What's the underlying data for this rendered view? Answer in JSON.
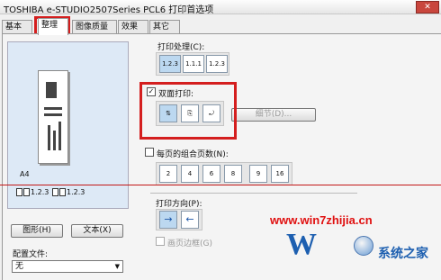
{
  "window": {
    "title": "TOSHIBA e-STUDIO2507Series PCL6 打印首选项",
    "close_glyph": "✕"
  },
  "tabs": [
    {
      "label": "基本",
      "active": false
    },
    {
      "label": "整理",
      "active": true
    },
    {
      "label": "图像质量",
      "active": false
    },
    {
      "label": "效果",
      "active": false
    },
    {
      "label": "其它",
      "active": false
    }
  ],
  "preview": {
    "paper_size": "A4",
    "page_order_1": "1.2.3",
    "page_order_2": "1.2.3"
  },
  "left_buttons": {
    "graphic": "图形(H)",
    "text": "文本(X)"
  },
  "profile": {
    "label": "配置文件:",
    "value": "无"
  },
  "print_process": {
    "label": "打印处理(C):",
    "options": [
      "1.2.3",
      "1.1.1",
      "1.2.3"
    ],
    "selected": 0
  },
  "duplex": {
    "label": "双面打印:",
    "checked": true,
    "options": [
      "book-icon",
      "tablet-icon",
      "flip-icon"
    ],
    "selected": 0,
    "details_button": "细节(D)..."
  },
  "nup": {
    "label": "每页的组合页数(N):",
    "checked": false,
    "options": [
      "2",
      "4",
      "6",
      "8",
      "9",
      "16"
    ]
  },
  "orientation": {
    "label": "打印方向(P):",
    "options": [
      "→",
      "←"
    ],
    "selected": 0
  },
  "border": {
    "label": "画页边框(G)",
    "checked": false
  },
  "watermark": {
    "site": "www.win7zhijia.cn",
    "logo_text": "W",
    "brand": "系统之家"
  },
  "colors": {
    "highlight": "#d41e1e",
    "brand": "#1d5fb0"
  }
}
